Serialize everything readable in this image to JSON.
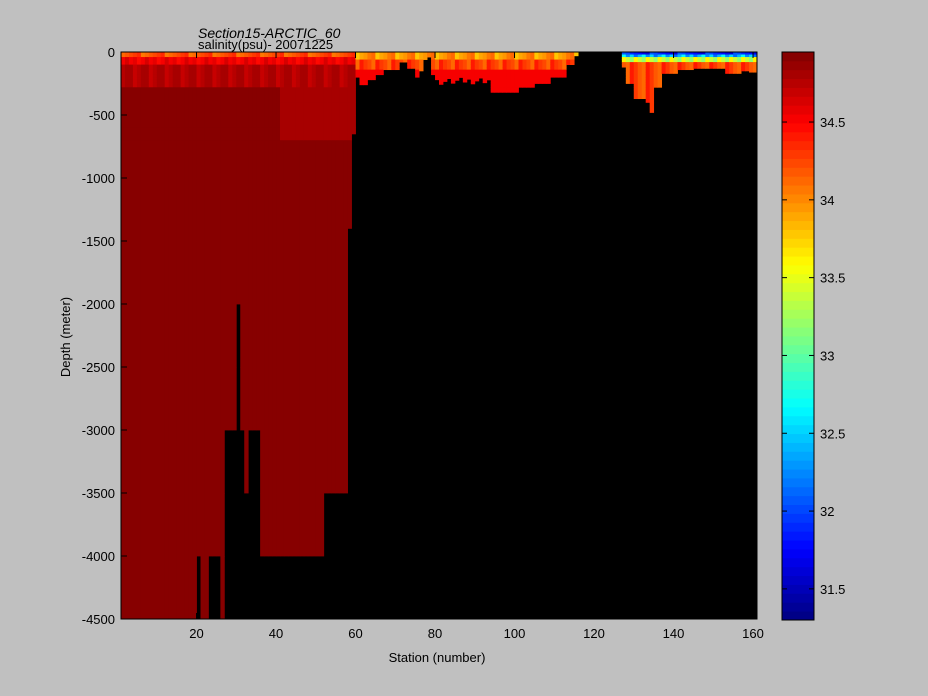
{
  "title_line1": "Section15-ARCTIC_60",
  "title_line2": "salinity(psu)- 20071225",
  "chart_data": {
    "type": "heatmap",
    "title": "Section15-ARCTIC_60",
    "subtitle": "salinity(psu)- 20071225",
    "xlabel": "Station (number)",
    "ylabel": "Depth (meter)",
    "xlim": [
      1,
      161
    ],
    "ylim": [
      -4500,
      0
    ],
    "x_ticks": [
      20,
      40,
      60,
      80,
      100,
      120,
      140,
      160
    ],
    "y_ticks": [
      0,
      -500,
      -1000,
      -1500,
      -2000,
      -2500,
      -3000,
      -3500,
      -4000,
      -4500
    ],
    "colorbar": {
      "range": [
        31.3,
        34.95
      ],
      "ticks": [
        31.5,
        32,
        32.5,
        33,
        33.5,
        34,
        34.5
      ],
      "colormap": "jet",
      "steps": 64
    },
    "land_color": "#000000",
    "description_regions": [
      {
        "stations": [
          1,
          59
        ],
        "depth": [
          -4500,
          -300
        ],
        "salinity": 34.9
      },
      {
        "stations": [
          1,
          60
        ],
        "depth": [
          -300,
          0
        ],
        "salinity_range": [
          34.1,
          34.8
        ]
      },
      {
        "stations": [
          76,
          115
        ],
        "depth": [
          -300,
          0
        ],
        "salinity_range": [
          33.8,
          34.6
        ]
      },
      {
        "stations": [
          127,
          160
        ],
        "depth": [
          -100,
          0
        ],
        "salinity_range": [
          31.6,
          33.2
        ]
      }
    ]
  }
}
